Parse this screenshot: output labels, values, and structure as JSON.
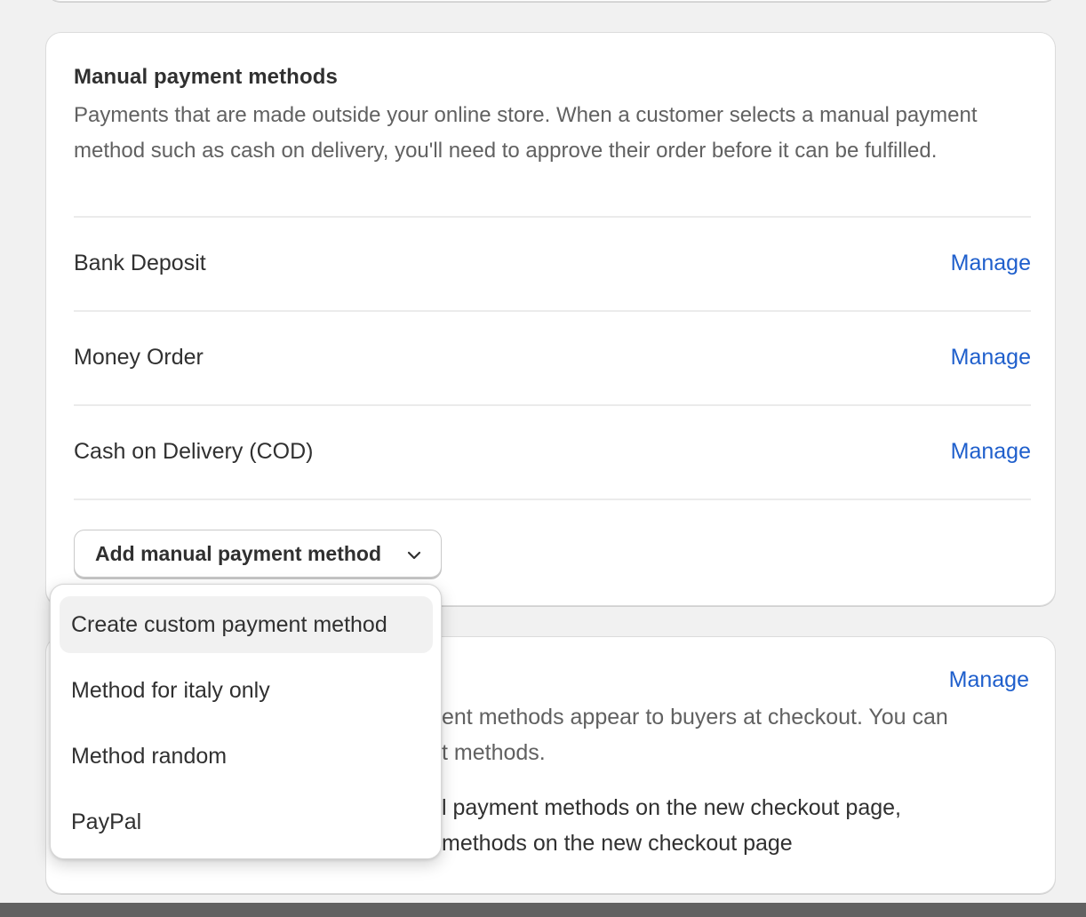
{
  "manual_section": {
    "title": "Manual payment methods",
    "description": "Payments that are made outside your online store. When a customer selects a manual payment method such as cash on delivery, you'll need to approve their order before it can be fulfilled.",
    "methods": [
      {
        "label": "Bank Deposit",
        "action": "Manage"
      },
      {
        "label": "Money Order",
        "action": "Manage"
      },
      {
        "label": "Cash on Delivery (COD)",
        "action": "Manage"
      }
    ],
    "add_button_label": "Add manual payment method"
  },
  "dropdown": {
    "items": [
      {
        "label": "Create custom payment method"
      },
      {
        "label": "Method for italy only"
      },
      {
        "label": "Method random"
      },
      {
        "label": "PayPal"
      }
    ]
  },
  "second_section": {
    "manage_label": "Manage",
    "line1": "ent methods appear to buyers at checkout. You can",
    "line2": "t methods.",
    "line3": "l payment methods on the new checkout page,",
    "line4": "methods on the new checkout page"
  },
  "icons": {
    "add_button_chevron": "chevron-down-icon"
  },
  "colors": {
    "link": "#1f5fcc",
    "background": "#f1f1f1",
    "bottom_bar": "#616161"
  }
}
